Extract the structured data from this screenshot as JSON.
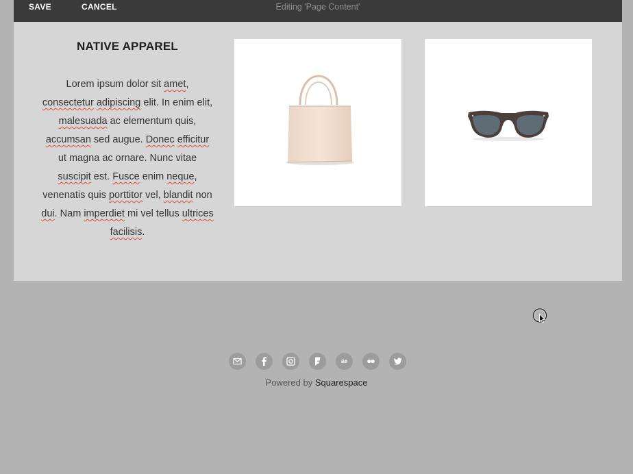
{
  "toolbar": {
    "save_label": "SAVE",
    "cancel_label": "CANCEL",
    "editing_label": "Editing 'Page Content'"
  },
  "content": {
    "brand_title": "NATIVE APPAREL",
    "paragraph": [
      {
        "t": "Lorem ipsum dolor sit "
      },
      {
        "t": "amet",
        "s": true
      },
      {
        "t": ", "
      },
      {
        "t": "consectetur",
        "s": true
      },
      {
        "t": " "
      },
      {
        "t": "adipiscing",
        "s": true
      },
      {
        "t": " elit. In enim elit, "
      },
      {
        "t": "malesuada",
        "s": true
      },
      {
        "t": " ac elementum quis, "
      },
      {
        "t": "accumsan",
        "s": true
      },
      {
        "t": " sed augue. "
      },
      {
        "t": "Donec",
        "s": true
      },
      {
        "t": " "
      },
      {
        "t": "efficitur",
        "s": true
      },
      {
        "t": " ut magna ac ornare. Nunc vitae "
      },
      {
        "t": "suscipit",
        "s": true
      },
      {
        "t": " est. "
      },
      {
        "t": "Fusce",
        "s": true
      },
      {
        "t": " enim "
      },
      {
        "t": "neque",
        "s": true
      },
      {
        "t": ", venenatis quis "
      },
      {
        "t": "porttitor",
        "s": true
      },
      {
        "t": " vel, "
      },
      {
        "t": "blandit",
        "s": true
      },
      {
        "t": " non "
      },
      {
        "t": "dui",
        "s": true
      },
      {
        "t": ". Nam "
      },
      {
        "t": "imperdiet",
        "s": true
      },
      {
        "t": " mi vel tellus "
      },
      {
        "t": "ultrices",
        "s": true
      },
      {
        "t": " "
      },
      {
        "t": "facilisis",
        "s": true
      },
      {
        "t": "."
      }
    ],
    "spellcheck_color": "#e04a3a",
    "products": [
      {
        "name": "tote-bag",
        "icon": "tote-bag-image"
      },
      {
        "name": "sunglasses",
        "icon": "sunglasses-image"
      }
    ]
  },
  "footer": {
    "social_icons": [
      "email-icon",
      "facebook-icon",
      "instagram-icon",
      "foursquare-icon",
      "behance-icon",
      "flickr-icon",
      "twitter-icon"
    ],
    "powered_prefix": "Powered by ",
    "powered_brand": "Squarespace"
  },
  "colors": {
    "toolbar_bg": "#3a3a3a",
    "content_bg": "#d6d6d6",
    "page_bg": "#b3b3b3"
  }
}
